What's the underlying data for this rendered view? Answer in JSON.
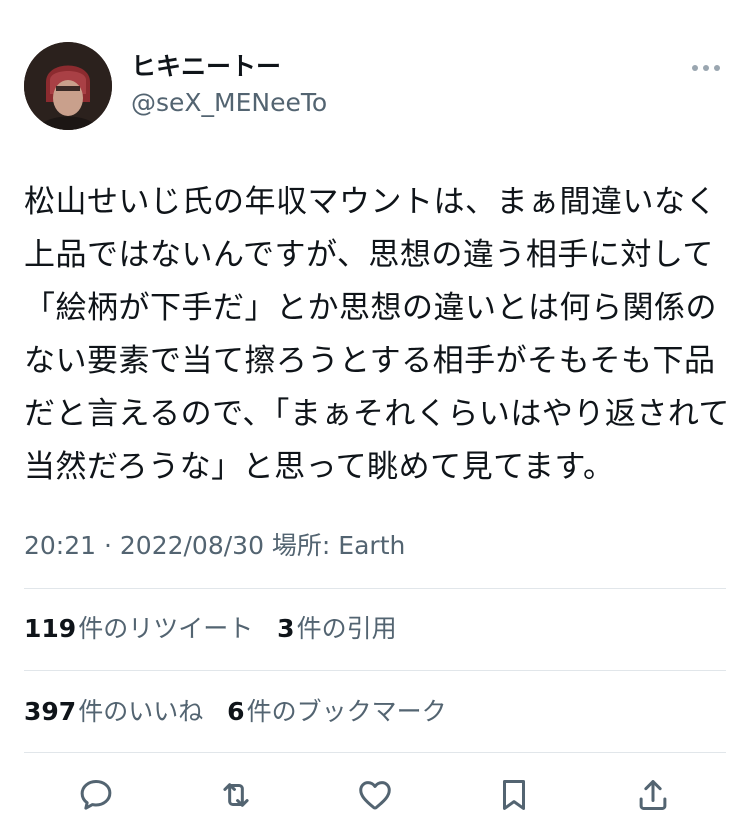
{
  "tweet": {
    "author": {
      "display_name": "ヒキニートー",
      "handle": "@seX_MENeeTo",
      "avatar_icon": "avatar-icon"
    },
    "text": "松山せいじ氏の年収マウントは、まぁ間違いなく上品ではないんですが、思想の違う相手に対して「絵柄が下手だ」とか思想の違いとは何ら関係のない要素で当て擦ろうとする相手がそもそも下品だと言えるので、「まぁそれくらいはやり返されて当然だろうな」と思って眺めて見てます。",
    "meta": "20:21 · 2022/08/30 場所: Earth",
    "stats": {
      "retweets": {
        "count": "119",
        "label": "件のリツイート"
      },
      "quotes": {
        "count": "3",
        "label": "件の引用"
      },
      "likes": {
        "count": "397",
        "label": "件のいいね"
      },
      "bookmarks": {
        "count": "6",
        "label": "件のブックマーク"
      }
    },
    "actions": [
      "reply-icon",
      "retweet-icon",
      "like-icon",
      "bookmark-icon",
      "share-icon"
    ]
  },
  "colors": {
    "text_primary": "#0f1419",
    "text_secondary": "#536471",
    "divider": "#e1e6ea",
    "icon": "#536471"
  }
}
